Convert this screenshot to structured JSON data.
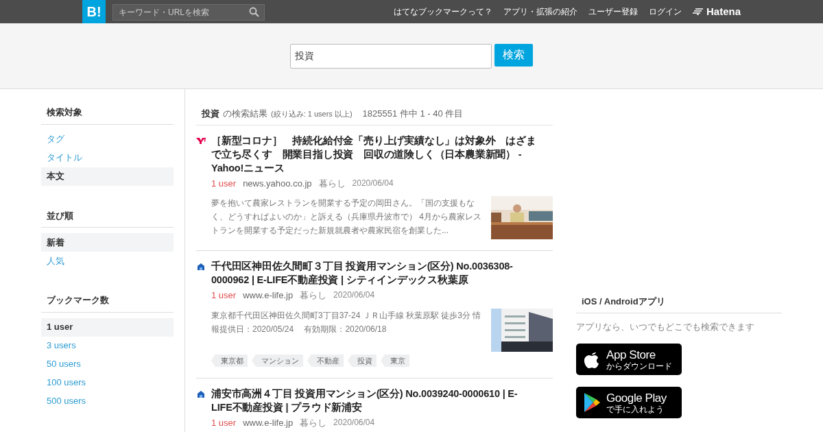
{
  "header": {
    "logo": "B!",
    "search_placeholder": "キーワード・URLを検索",
    "links": [
      "はてなブックマークって？",
      "アプリ・拡張の紹介",
      "ユーザー登録",
      "ログイン"
    ],
    "brand": "Hatena"
  },
  "search": {
    "value": "投資",
    "button": "検索"
  },
  "sidebar": [
    {
      "title": "検索対象",
      "items": [
        {
          "label": "タグ",
          "selected": false
        },
        {
          "label": "タイトル",
          "selected": false
        },
        {
          "label": "本文",
          "selected": true
        }
      ]
    },
    {
      "title": "並び順",
      "items": [
        {
          "label": "新着",
          "selected": true
        },
        {
          "label": "人気",
          "selected": false
        }
      ]
    },
    {
      "title": "ブックマーク数",
      "items": [
        {
          "label": "1 user",
          "selected": true
        },
        {
          "label": "3 users",
          "selected": false
        },
        {
          "label": "50 users",
          "selected": false
        },
        {
          "label": "100 users",
          "selected": false
        },
        {
          "label": "500 users",
          "selected": false
        }
      ]
    }
  ],
  "results_header": {
    "query": "投資",
    "suffix": "の検索結果",
    "filter": "(絞り込み: 1 users 以上)",
    "count": "1825551 件中 1 - 40 件目"
  },
  "results": [
    {
      "kind": "news",
      "title": "［新型コロナ］　持続化給付金「売り上げ実績なし」は対象外　はざまで立ち尽くす　開業目指し投資　回収の道険しく（日本農業新聞） - Yahoo!ニュース",
      "users": "1 user",
      "domain": "news.yahoo.co.jp",
      "category": "暮らし",
      "date": "2020/06/04",
      "summary": "夢を抱いて農家レストランを開業する予定の岡田さん。「国の支援もなく、どうすればよいのか」と訴える（兵庫県丹波市で） 4月から農家レストランを開業する予定だった新規就農者や農家民宿を創業した..."
    },
    {
      "kind": "property",
      "title": "千代田区神田佐久間町３丁目 投資用マンション(区分) No.0036308-0000962 | E-LIFE不動産投資 | シティインデックス秋葉原",
      "users": "1 user",
      "domain": "www.e-life.jp",
      "category": "暮らし",
      "date": "2020/06/04",
      "summary": "東京都千代田区神田佐久間町3丁目37-24 ＪＲ山手線 秋葉原駅 徒歩3分 情報提供日：2020/05/24　 有効期限：2020/06/18",
      "tags": [
        "東京都",
        "マンション",
        "不動産",
        "投資",
        "東京"
      ]
    },
    {
      "kind": "property",
      "title": "浦安市高洲４丁目 投資用マンション(区分) No.0039240-0000610 | E-LIFE不動産投資 | プラウド新浦安",
      "users": "1 user",
      "domain": "www.e-life.jp",
      "category": "暮らし",
      "date": "2020/06/04"
    }
  ],
  "apps": {
    "title": "iOS / Androidアプリ",
    "text": "アプリなら、いつでもどこでも検索できます",
    "badges": [
      {
        "kind": "apple",
        "main": "App Store",
        "sub": "からダウンロード"
      },
      {
        "kind": "google",
        "main": "Google Play",
        "sub": "で手に入れよう"
      }
    ]
  }
}
